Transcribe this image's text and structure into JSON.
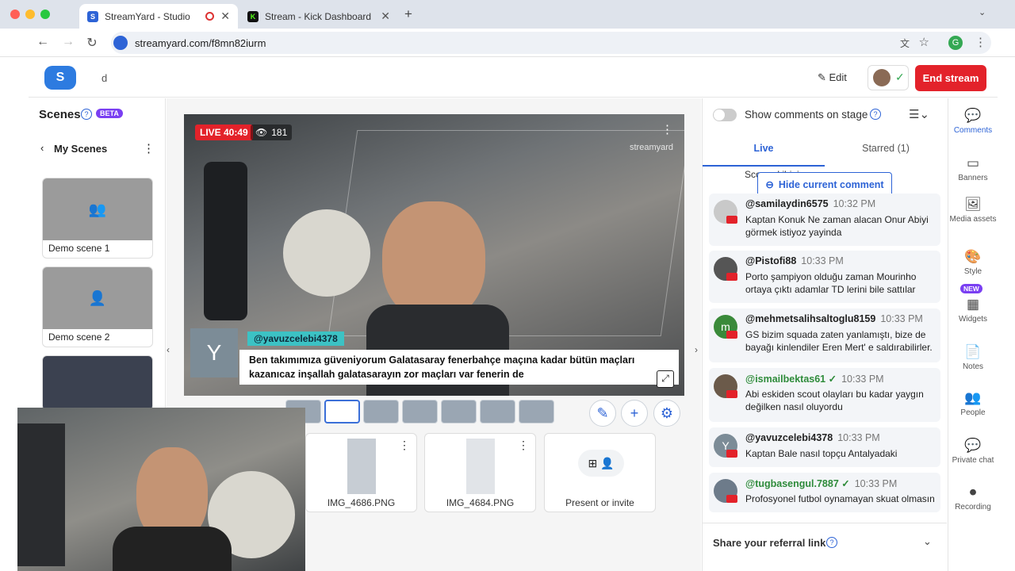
{
  "browser": {
    "tabs": [
      {
        "label": "StreamYard - Studio",
        "active": true
      },
      {
        "label": "Stream - Kick Dashboard",
        "active": false
      }
    ],
    "url": "streamyard.com/f8mn82iurm",
    "profile_initial": "G"
  },
  "header": {
    "broadcast_name": "d",
    "edit_label": "Edit",
    "end_label": "End stream"
  },
  "scenes": {
    "title": "Scenes",
    "beta": "BETA",
    "back_label": "My Scenes",
    "items": [
      {
        "name": "Demo scene 1"
      },
      {
        "name": "Demo scene 2"
      }
    ]
  },
  "stage": {
    "live_label": "LIVE 40:49",
    "viewers": "181",
    "watermark": "streamyard",
    "banner": {
      "avatar": "Y",
      "handle": "@yavuzcelebi4378",
      "text": "Ben takımımıza güveniyorum Galatasaray fenerbahçe maçına kadar bütün maçları kazanıcaz inşallah galatasarayın zor maçları var fenerin de"
    }
  },
  "assets": [
    {
      "label": "IMG_4686.PNG"
    },
    {
      "label": "IMG_4684.PNG"
    },
    {
      "label": "Present or invite"
    }
  ],
  "comments": {
    "toggle_label": "Show comments on stage",
    "tabs": {
      "live": "Live",
      "starred": "Starred (1)"
    },
    "hide_label": "Hide current comment",
    "partial_text": "Scour ekibini",
    "items": [
      {
        "user": "@samilaydin6575",
        "time": "10:32 PM",
        "text": "Kaptan Konuk Ne zaman alacan Onur Abiyi görmek istiyoz yayinda",
        "avatar": "",
        "color": "#c9c9c9",
        "green": false
      },
      {
        "user": "@Pistofi88",
        "time": "10:33 PM",
        "text": "Porto şampiyon olduğu zaman Mourinho ortaya çıktı adamlar TD lerini bile sattılar",
        "avatar": "",
        "color": "#555",
        "green": false
      },
      {
        "user": "@mehmetsalihsaltoglu8159",
        "time": "10:33 PM",
        "text": "GS bizim squada zaten yanlamıştı, bize de bayağı kinlendiler Eren Mert' e saldırabilirler.",
        "avatar": "m",
        "color": "#3a8a3a",
        "green": false
      },
      {
        "user": "@ismailbektas61",
        "time": "10:33 PM",
        "text": "Abi eskiden scout olayları bu kadar yaygın değilken nasıl oluyordu",
        "avatar": "",
        "color": "#6b5a4a",
        "green": true
      },
      {
        "user": "@yavuzcelebi4378",
        "time": "10:33 PM",
        "text": "Kaptan Bale nasıl topçu Antalyadaki",
        "avatar": "Y",
        "color": "#7c8c97",
        "green": false
      },
      {
        "user": "@tugbasengul.7887",
        "time": "10:33 PM",
        "text": "Profosyonel futbol oynamayan skuat olmasın",
        "avatar": "",
        "color": "#6d7b8a",
        "green": true
      }
    ],
    "referral": "Share your referral link"
  },
  "rail": [
    {
      "label": "Comments",
      "icon": "💬"
    },
    {
      "label": "Banners",
      "icon": "▭"
    },
    {
      "label": "Media assets",
      "icon": "🖼"
    },
    {
      "label": "Style",
      "icon": "🎨"
    },
    {
      "label": "Widgets",
      "icon": "▦",
      "badge": "NEW"
    },
    {
      "label": "Notes",
      "icon": "📄"
    },
    {
      "label": "People",
      "icon": "👥"
    },
    {
      "label": "Private chat",
      "icon": "💬"
    },
    {
      "label": "Recording",
      "icon": "⏺"
    }
  ]
}
